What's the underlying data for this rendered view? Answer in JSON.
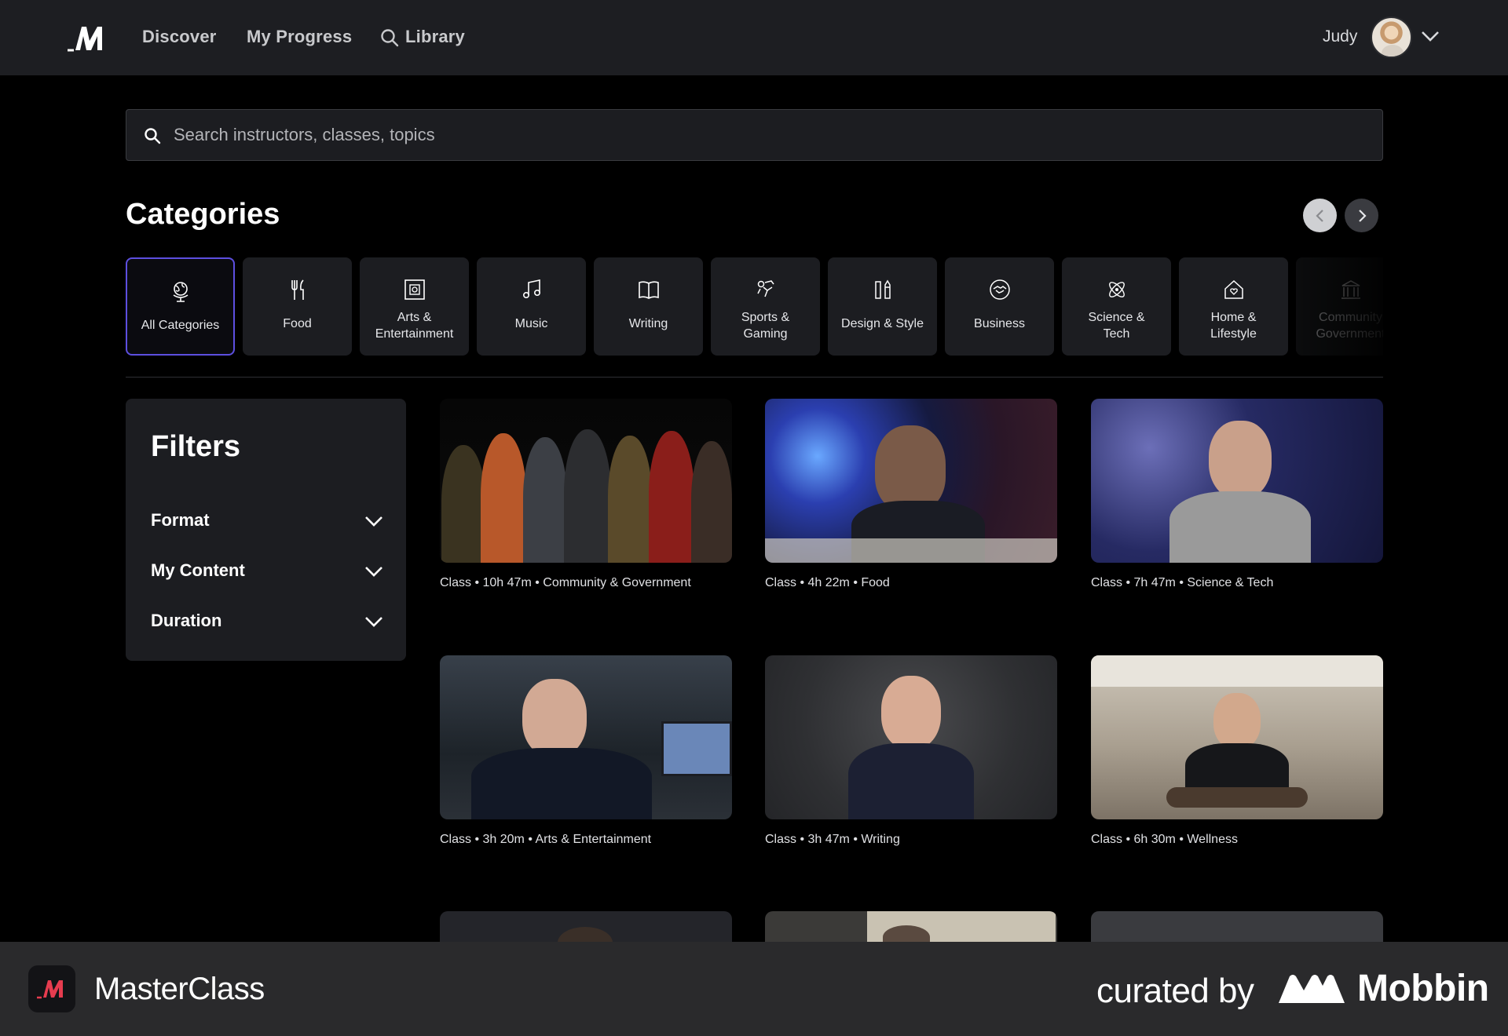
{
  "nav": {
    "links": [
      "Discover",
      "My Progress",
      "Library"
    ],
    "user_name": "Judy"
  },
  "search": {
    "placeholder": "Search instructors, classes, topics"
  },
  "categories": {
    "title": "Categories",
    "items": [
      {
        "label": "All Categories",
        "icon": "globe-icon",
        "active": true
      },
      {
        "label": "Food",
        "icon": "fork-knife-icon"
      },
      {
        "label": "Arts &\nEntertainment",
        "icon": "film-frame-icon"
      },
      {
        "label": "Music",
        "icon": "music-note-icon"
      },
      {
        "label": "Writing",
        "icon": "open-book-icon"
      },
      {
        "label": "Sports &\nGaming",
        "icon": "sports-icon"
      },
      {
        "label": "Design & Style",
        "icon": "design-tools-icon"
      },
      {
        "label": "Business",
        "icon": "handshake-icon"
      },
      {
        "label": "Science &\nTech",
        "icon": "atom-icon"
      },
      {
        "label": "Home &\nLifestyle",
        "icon": "home-heart-icon"
      },
      {
        "label": "Community\nGovernment",
        "icon": "government-building-icon"
      }
    ]
  },
  "filters": {
    "title": "Filters",
    "items": [
      "Format",
      "My Content",
      "Duration"
    ]
  },
  "classes": [
    {
      "meta": "Class • 10h 47m • Community & Government"
    },
    {
      "meta": "Class • 4h 22m • Food"
    },
    {
      "meta": "Class • 7h 47m • Science & Tech"
    },
    {
      "meta": "Class • 3h 20m • Arts & Entertainment"
    },
    {
      "meta": "Class • 3h 47m • Writing"
    },
    {
      "meta": "Class • 6h 30m • Wellness"
    }
  ],
  "footer": {
    "app_name": "MasterClass",
    "curated_by": "curated by",
    "brand": "Mobbin"
  },
  "colors": {
    "nav_bg": "#1d1e22",
    "page_bg": "#000000",
    "active_border": "#5d4fe0",
    "footer_bg": "#2a2a2c"
  }
}
